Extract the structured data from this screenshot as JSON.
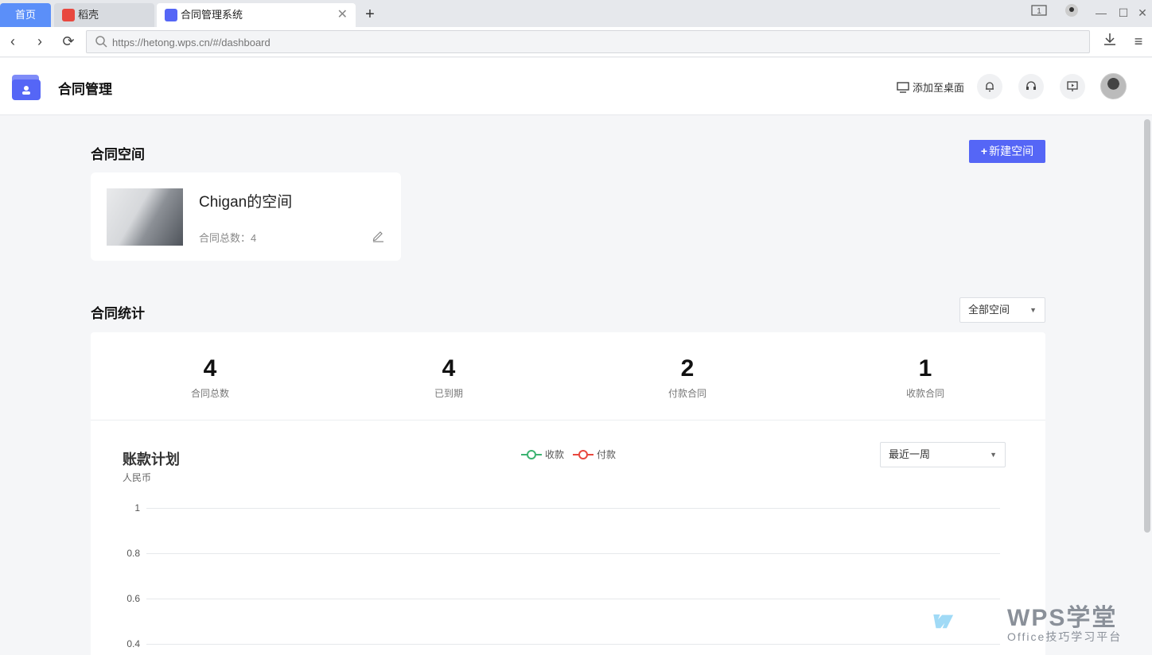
{
  "browser": {
    "tabs": [
      {
        "label": "首页"
      },
      {
        "label": "稻壳"
      },
      {
        "label": "合同管理系统"
      }
    ],
    "url_placeholder": "https://hetong.wps.cn/#/dashboard"
  },
  "header": {
    "title": "合同管理",
    "add_to_desktop": "添加至桌面"
  },
  "spaces": {
    "title": "合同空间",
    "new_button": "新建空间",
    "items": [
      {
        "name": "Chigan的空间",
        "count_label": "合同总数：4"
      }
    ]
  },
  "stats": {
    "title": "合同统计",
    "filter": "全部空间",
    "items": [
      {
        "value": "4",
        "label": "合同总数"
      },
      {
        "value": "4",
        "label": "已到期"
      },
      {
        "value": "2",
        "label": "付款合同"
      },
      {
        "value": "1",
        "label": "收款合同"
      }
    ]
  },
  "chart": {
    "title": "账款计划",
    "unit": "人民币",
    "range_filter": "最近一周",
    "legend": [
      "收款",
      "付款"
    ],
    "colors": {
      "receipt": "#3cb371",
      "payment": "#e8483f"
    }
  },
  "chart_data": {
    "type": "line",
    "title": "账款计划",
    "ylabel": "人民币",
    "series": [
      {
        "name": "收款",
        "values": []
      },
      {
        "name": "付款",
        "values": []
      }
    ],
    "y_ticks": [
      "1",
      "0.8",
      "0.6",
      "0.4"
    ],
    "ylim": [
      0,
      1
    ],
    "grid": true,
    "legend_position": "top-center"
  },
  "watermark": {
    "brand": "WPS学堂",
    "tagline": "Office技巧学习平台"
  }
}
